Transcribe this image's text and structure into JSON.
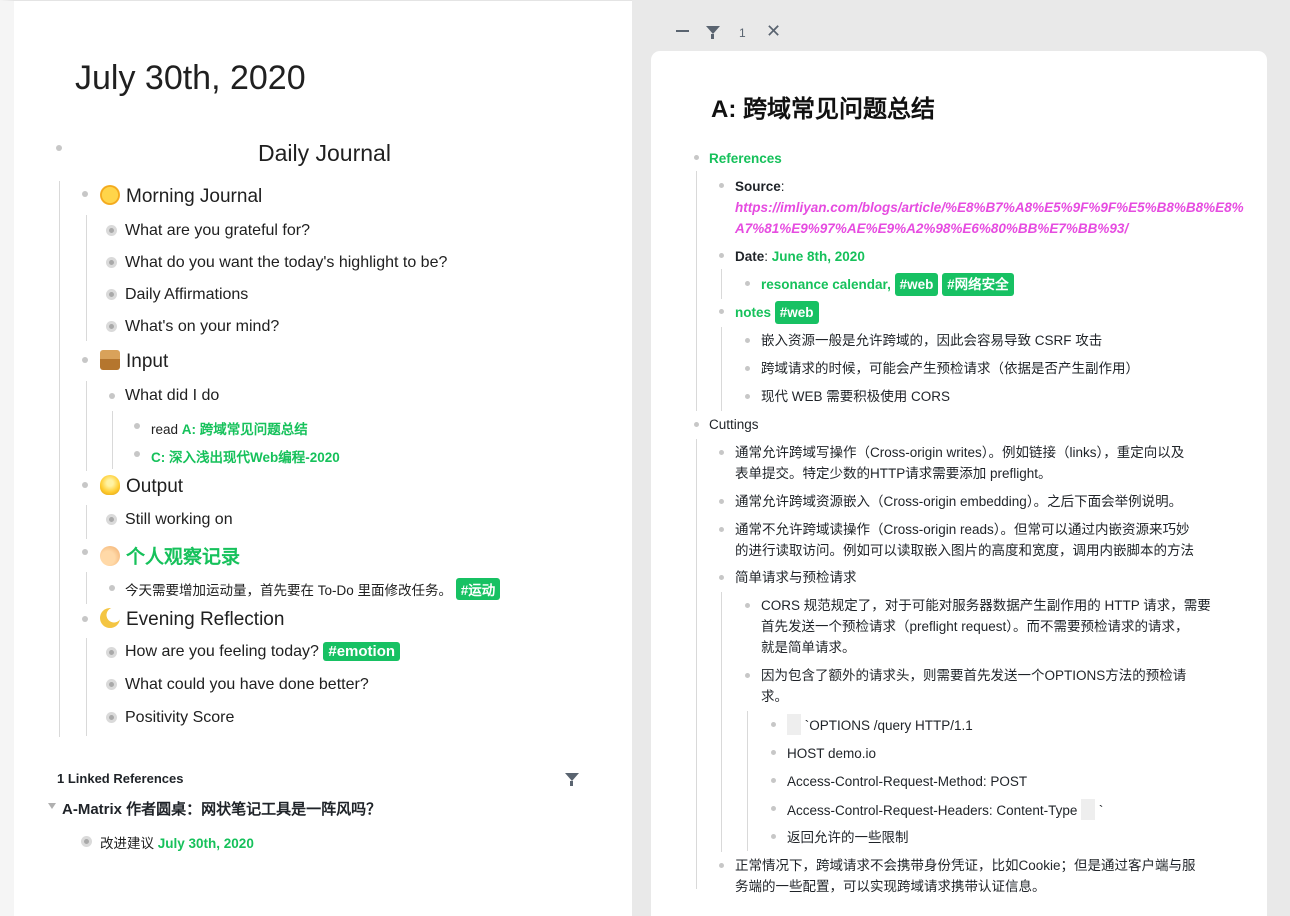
{
  "left": {
    "page_title": "July 30th, 2020",
    "daily_journal": "Daily Journal",
    "morning": {
      "title": "Morning Journal",
      "items": [
        "What are you grateful for?",
        "What do you want the today's highlight to be?",
        "Daily Affirmations",
        "What's on your mind?"
      ]
    },
    "input": {
      "title": "Input",
      "what_did": "What did I do",
      "read_prefix": "read",
      "read_link": "A: 跨域常见问题总结",
      "second_link": "C: 深入浅出现代Web编程-2020"
    },
    "output": {
      "title": "Output",
      "item": "Still working on"
    },
    "observe": {
      "title": "个人观察记录",
      "item": "今天需要增加运动量，首先要在 To-Do 里面修改任务。",
      "tag": "#运动"
    },
    "evening": {
      "title": "Evening Reflection",
      "items": [
        "How are you feeling today?",
        "What could you have done better?",
        "Positivity Score"
      ],
      "tag": "#emotion"
    },
    "linked_refs": {
      "heading": "1 Linked References",
      "page": "A-Matrix 作者圆桌：网状笔记工具是一阵风吗？",
      "item_prefix": "改进建议",
      "item_link": "July 30th, 2020"
    }
  },
  "right": {
    "controls": {
      "count": "1"
    },
    "title": "A: 跨域常见问题总结",
    "references": "References",
    "source_label": "Source",
    "source_url_1": "https://imliyan.com/blogs/article/%E8%B7%A8%E5%9F%9F%E5%B8%B8%E8%",
    "source_url_2": "A7%81%E9%97%AE%E9%A2%98%E6%80%BB%E7%BB%93/",
    "date_label": "Date",
    "date_value": "June 8th, 2020",
    "resonance": "resonance calendar",
    "tag_web": "#web",
    "tag_security": "#网络安全",
    "notes": "notes",
    "notes_items": [
      "嵌入资源一般是允许跨域的，因此会容易导致 CSRF 攻击",
      "跨域请求的时候，可能会产生预检请求（依据是否产生副作用）",
      "现代 WEB 需要积极使用 CORS"
    ],
    "cuttings": "Cuttings",
    "c1a": "通常允许跨域写操作（Cross-origin writes）。例如链接（links），重定向以及",
    "c1b": "表单提交。特定少数的HTTP请求需要添加 preflight。",
    "c2": "通常允许跨域资源嵌入（Cross-origin embedding）。之后下面会举例说明。",
    "c3a": "通常不允许跨域读操作（Cross-origin reads）。但常可以通过内嵌资源来巧妙",
    "c3b": "的进行读取访问。例如可以读取嵌入图片的高度和宽度，调用内嵌脚本的方法",
    "c4": "简单请求与预检请求",
    "c4a_1": "CORS 规范规定了，对于可能对服务器数据产生副作用的 HTTP 请求，需要",
    "c4a_2": "首先发送一个预检请求（preflight request）。而不需要预检请求的请求，",
    "c4a_3": "就是简单请求。",
    "c4b_1": "因为包含了额外的请求头，则需要首先发送一个OPTIONS方法的预检请",
    "c4b_2": "求。",
    "code": [
      "`OPTIONS /query HTTP/1.1",
      "HOST demo.io",
      "Access-Control-Request-Method: POST",
      "Access-Control-Request-Headers: Content-Type",
      "返回允许的一些限制"
    ],
    "code_tick": "`",
    "c5a": "正常情况下，跨域请求不会携带身份凭证，比如Cookie；但是通过客户端与服",
    "c5b": "务端的一些配置，可以实现跨域请求携带认证信息。"
  }
}
